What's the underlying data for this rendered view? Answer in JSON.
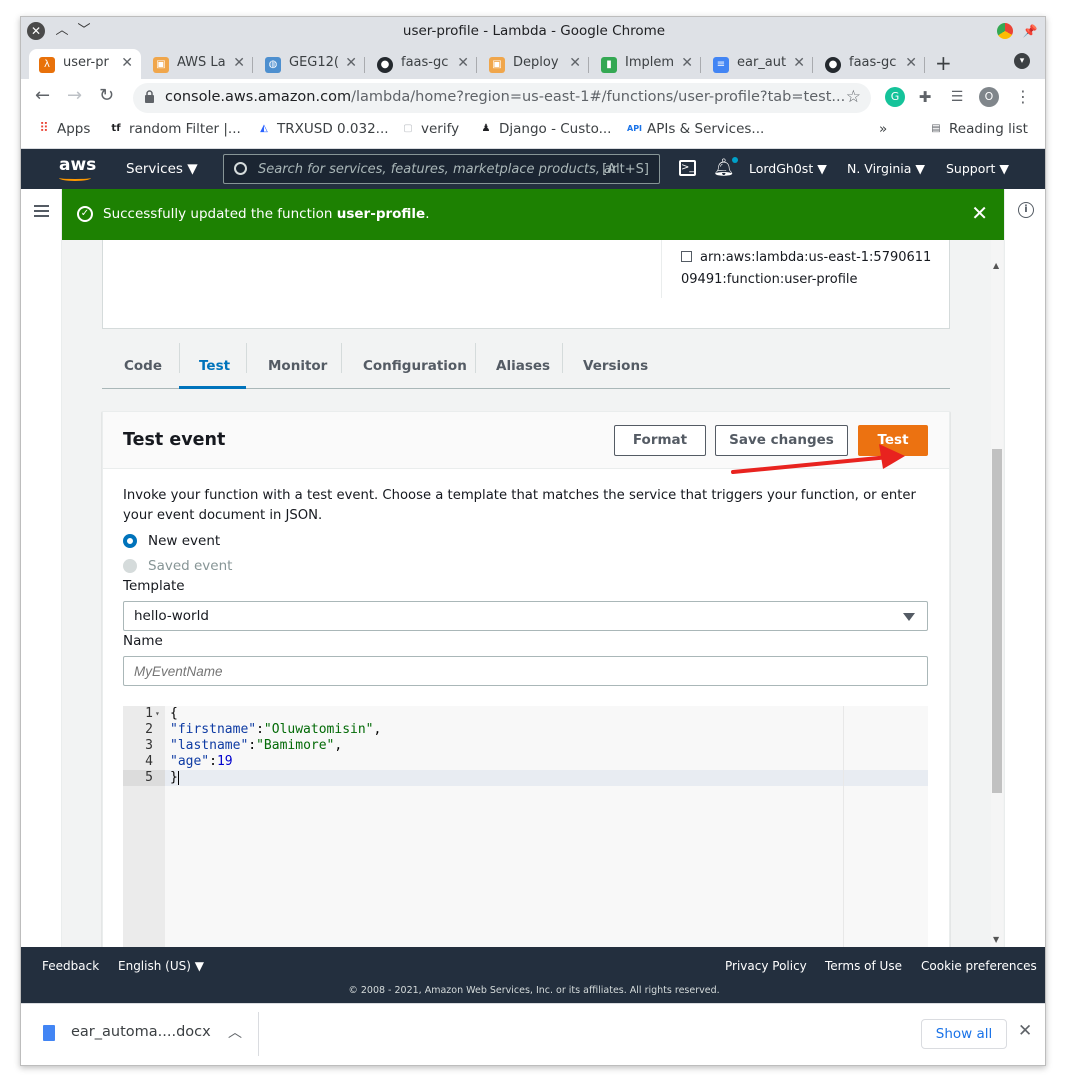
{
  "window": {
    "title": "user-profile - Lambda - Google Chrome"
  },
  "tabs": [
    {
      "label": "user-pr",
      "icon": "lambda-icon",
      "color": "#e8710a"
    },
    {
      "label": "AWS La",
      "icon": "aws-box-icon",
      "color": "#f0a64b"
    },
    {
      "label": "GEG12(",
      "icon": "globe-icon",
      "color": "#4d8fcf"
    },
    {
      "label": "faas-gc",
      "icon": "github-icon",
      "color": "#24292e"
    },
    {
      "label": "Deploy",
      "icon": "aws-box-icon",
      "color": "#f0a64b"
    },
    {
      "label": "Implem",
      "icon": "bookmark-green-icon",
      "color": "#34a853"
    },
    {
      "label": "ear_aut",
      "icon": "docs-icon",
      "color": "#4285f4"
    },
    {
      "label": "faas-gc",
      "icon": "github-icon",
      "color": "#24292e"
    }
  ],
  "omnibox": {
    "host": "console.aws.amazon.com",
    "path": "/lambda/home?region=us-east-1#/functions/user-profile?tab=test..."
  },
  "bookmarks": [
    {
      "label": "Apps",
      "icon": "apps-grid-icon"
    },
    {
      "label": "random Filter |...",
      "icon": "tf-icon"
    },
    {
      "label": "TRXUSD 0.032...",
      "icon": "trading-icon"
    },
    {
      "label": "verify",
      "icon": "page-icon"
    },
    {
      "label": "Django - Custo...",
      "icon": "person-icon"
    },
    {
      "label": "APIs & Services...",
      "icon": "api-icon"
    }
  ],
  "bookmarks_overflow": "»",
  "reading_list": "Reading list",
  "profile_initial": "O",
  "aws_nav": {
    "logo": "aws",
    "services": "Services",
    "search_placeholder": "Search for services, features, marketplace products, ar",
    "search_shortcut": "[Alt+S]",
    "user": "LordGh0st",
    "region": "N. Virginia",
    "support": "Support"
  },
  "flash": {
    "prefix": "Successfully updated the function ",
    "function_name": "user-profile",
    "suffix": "."
  },
  "summary": {
    "arn_line1": "arn:aws:lambda:us-east-1:5790611",
    "arn_line2": "09491:function:user-profile"
  },
  "lambda_tabs": [
    "Code",
    "Test",
    "Monitor",
    "Configuration",
    "Aliases",
    "Versions"
  ],
  "active_tab": "Test",
  "test_event": {
    "title": "Test event",
    "format_label": "Format",
    "save_label": "Save changes",
    "test_label": "Test",
    "description": "Invoke your function with a test event. Choose a template that matches the service that triggers your function, or enter your event document in JSON.",
    "new_event_label": "New event",
    "saved_event_label": "Saved event",
    "template_label": "Template",
    "template_value": "hello-world",
    "name_label": "Name",
    "name_placeholder": "MyEventName"
  },
  "editor": {
    "line_numbers": [
      "1",
      "2",
      "3",
      "4",
      "5"
    ],
    "l1": "{",
    "l2_key": "\"firstname\"",
    "l2_val": "\"Oluwatomisin\"",
    "l3_key": "\"lastname\"",
    "l3_val": "\"Bamimore\"",
    "l4_key": "\"age\"",
    "l4_val": "19",
    "l5": "}"
  },
  "footer": {
    "feedback": "Feedback",
    "language": "English (US)",
    "privacy": "Privacy Policy",
    "terms": "Terms of Use",
    "cookies": "Cookie preferences",
    "copyright": "© 2008 - 2021, Amazon Web Services, Inc. or its affiliates. All rights reserved."
  },
  "downloads": {
    "file": "ear_automa....docx",
    "show_all": "Show all"
  },
  "colors": {
    "aws_nav": "#232f3e",
    "success": "#1d8102",
    "primary_button": "#ec7211",
    "active_tab": "#0073bb",
    "annotation_arrow": "#e8231f"
  }
}
